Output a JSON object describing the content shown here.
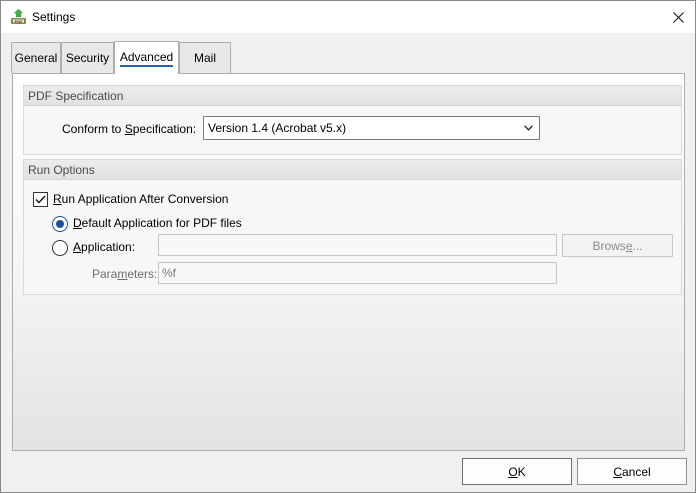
{
  "window": {
    "title": "Settings",
    "close_glyph": "✕"
  },
  "tabs": [
    {
      "label": "General",
      "active": false
    },
    {
      "label": "Security",
      "active": false
    },
    {
      "label": "Advanced",
      "active": true
    },
    {
      "label": "Mail",
      "active": false
    }
  ],
  "pdf_spec": {
    "header": "PDF Specification",
    "conform_label_pre": "Conform to ",
    "conform_label_accel": "S",
    "conform_label_post": "pecification:",
    "selected_value": "Version 1.4 (Acrobat v5.x)"
  },
  "run_options": {
    "header": "Run Options",
    "run_after": {
      "accel": "R",
      "rest": "un Application After Conversion",
      "checked": true
    },
    "default_app": {
      "accel": "D",
      "rest": "efault Application for PDF files",
      "checked": true
    },
    "application": {
      "accel": "A",
      "rest": "pplication:",
      "checked": false,
      "value": ""
    },
    "browse_pre": "Brows",
    "browse_accel": "e",
    "browse_post": "...",
    "parameters_pre": "Para",
    "parameters_accel": "m",
    "parameters_post": "eters:",
    "parameters_value": "%f"
  },
  "buttons": {
    "ok_accel": "O",
    "ok_rest": "K",
    "cancel_accel": "C",
    "cancel_rest": "ancel"
  },
  "colors": {
    "accent": "#1a4f9c",
    "tab_underline": "#2a5fb0"
  },
  "icons": {
    "app": "pdf-printer-app-icon",
    "close": "close-icon",
    "dropdown": "chevron-down-icon",
    "check": "checkmark-icon"
  }
}
